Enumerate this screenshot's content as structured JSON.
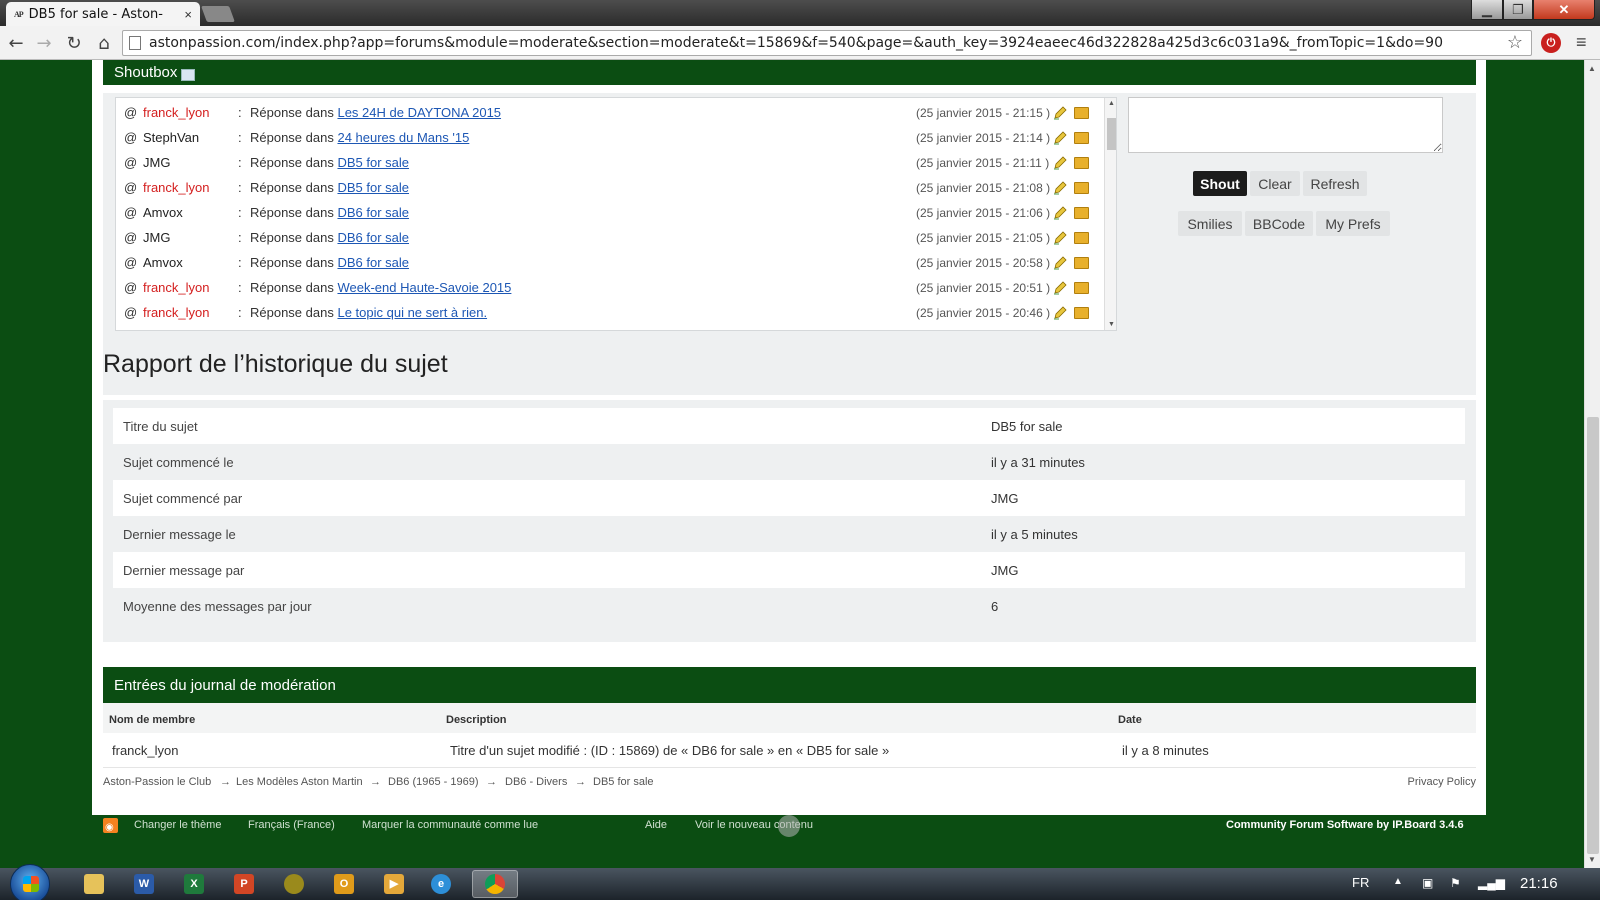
{
  "browser": {
    "tab_title": "DB5 for sale - Aston-",
    "tab_favicon": "AP",
    "tab_close": "×",
    "url": "astonpassion.com/index.php?app=forums&module=moderate&section=moderate&t=15869&f=540&page=&auth_key=3924eaeec46d322828a425d3c6c031a9&_fromTopic=1&do=90"
  },
  "shoutbox": {
    "title": "Shoutbox",
    "rows": [
      {
        "at": "@",
        "user": "franck_lyon",
        "color": "red",
        "colon": ":",
        "prefix": "Réponse dans",
        "topic": "Les 24H de DAYTONA 2015",
        "date": "(25 janvier 2015 - 21:15 )"
      },
      {
        "at": "@",
        "user": "StephVan",
        "color": "dark",
        "colon": ":",
        "prefix": "Réponse dans",
        "topic": "24 heures du Mans '15",
        "date": "(25 janvier 2015 - 21:14 )"
      },
      {
        "at": "@",
        "user": "JMG",
        "color": "dark",
        "colon": ":",
        "prefix": "Réponse dans",
        "topic": "DB5 for sale",
        "date": "(25 janvier 2015 - 21:11 )"
      },
      {
        "at": "@",
        "user": "franck_lyon",
        "color": "red",
        "colon": ":",
        "prefix": "Réponse dans",
        "topic": "DB5 for sale",
        "date": "(25 janvier 2015 - 21:08 )"
      },
      {
        "at": "@",
        "user": "Amvox",
        "color": "dark",
        "colon": ":",
        "prefix": "Réponse dans",
        "topic": "DB6 for sale",
        "date": "(25 janvier 2015 - 21:06 )"
      },
      {
        "at": "@",
        "user": "JMG",
        "color": "dark",
        "colon": ":",
        "prefix": "Réponse dans",
        "topic": "DB6 for sale",
        "date": "(25 janvier 2015 - 21:05 )"
      },
      {
        "at": "@",
        "user": "Amvox",
        "color": "dark",
        "colon": ":",
        "prefix": "Réponse dans",
        "topic": "DB6 for sale",
        "date": "(25 janvier 2015 - 20:58 )"
      },
      {
        "at": "@",
        "user": "franck_lyon",
        "color": "red",
        "colon": ":",
        "prefix": "Réponse dans",
        "topic": "Week-end Haute-Savoie 2015",
        "date": "(25 janvier 2015 - 20:51 )"
      },
      {
        "at": "@",
        "user": "franck_lyon",
        "color": "red",
        "colon": ":",
        "prefix": "Réponse dans",
        "topic": "Le topic qui ne sert à rien.",
        "date": "(25 janvier 2015 - 20:46 )"
      }
    ],
    "buttons": {
      "shout": "Shout",
      "clear": "Clear",
      "refresh": "Refresh",
      "smilies": "Smilies",
      "bbcode": "BBCode",
      "myprefs": "My Prefs"
    }
  },
  "report": {
    "title": "Rapport de l’historique du sujet",
    "rows": [
      {
        "label": "Titre du sujet",
        "value": "DB5 for sale"
      },
      {
        "label": "Sujet commencé le",
        "value": "il y a 31 minutes"
      },
      {
        "label": "Sujet commencé par",
        "value": "JMG"
      },
      {
        "label": "Dernier message le",
        "value": "il y a 5 minutes"
      },
      {
        "label": "Dernier message par",
        "value": "JMG"
      },
      {
        "label": "Moyenne des messages par jour",
        "value": "6"
      }
    ]
  },
  "modlog": {
    "title": "Entrées du journal de modération",
    "columns": {
      "member": "Nom de membre",
      "description": "Description",
      "date": "Date"
    },
    "entry": {
      "member": "franck_lyon",
      "description": "Titre d'un sujet modifié : (ID : 15869) de « DB6 for sale » en « DB5 for sale »",
      "date": "il y a 8 minutes"
    }
  },
  "breadcrumb": {
    "items": [
      "Aston-Passion le Club",
      "Les Modèles Aston Martin",
      "DB6 (1965 - 1969)",
      "DB6 - Divers",
      "DB5 for sale"
    ],
    "separator": "→",
    "privacy": "Privacy Policy"
  },
  "footer": {
    "change_theme": "Changer le thème",
    "language": "Français (France)",
    "mark_read": "Marquer la communauté comme lue",
    "help": "Aide",
    "new_content": "Voir le nouveau contenu",
    "powered_by": "Community Forum Software by IP.Board 3.4.6"
  },
  "taskbar": {
    "lang": "FR",
    "clock": "21:16",
    "apps": [
      "folder-icon",
      "word-icon",
      "excel-icon",
      "powerpoint-icon",
      "app-icon",
      "outlook-icon",
      "media-icon",
      "ie-icon",
      "chrome-icon"
    ]
  },
  "colors": {
    "brand_green": "#0b4d12",
    "link_blue": "#1d57b4",
    "user_red": "#d42020"
  }
}
